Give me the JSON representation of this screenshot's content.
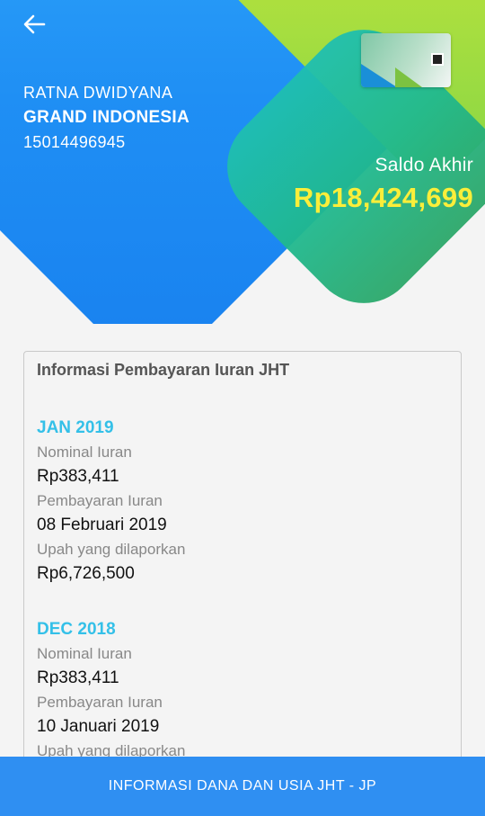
{
  "header": {
    "user_name": "RATNA DWIDYANA",
    "company": "GRAND INDONESIA",
    "card_number": "15014496945",
    "saldo_label": "Saldo Akhir",
    "saldo_value": "Rp18,424,699",
    "back_icon": "arrow-left-icon"
  },
  "info": {
    "title": "Informasi Pembayaran Iuran JHT",
    "entries": [
      {
        "period": "JAN 2019",
        "nominal_label": "Nominal Iuran",
        "nominal_value": "Rp383,411",
        "payment_label": "Pembayaran Iuran",
        "payment_value": "08 Februari 2019",
        "wage_label": "Upah yang dilaporkan",
        "wage_value": "Rp6,726,500"
      },
      {
        "period": "DEC 2018",
        "nominal_label": "Nominal Iuran",
        "nominal_value": "Rp383,411",
        "payment_label": "Pembayaran Iuran",
        "payment_value": "10 Januari 2019",
        "wage_label": "Upah yang dilaporkan"
      }
    ]
  },
  "footer": {
    "button_label": "INFORMASI DANA DAN USIA JHT - JP"
  },
  "colors": {
    "accent_blue": "#2f8ff2",
    "period_color": "#34c0e8",
    "saldo_color": "#fbee3a"
  }
}
